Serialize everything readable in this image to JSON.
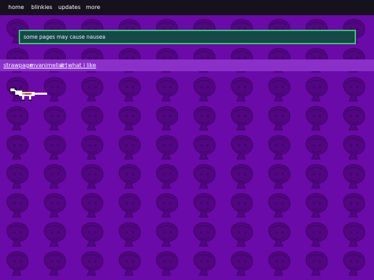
{
  "nav": {
    "items": [
      {
        "label": "home"
      },
      {
        "label": "blinkies"
      },
      {
        "label": "updates"
      },
      {
        "label": "more"
      }
    ]
  },
  "warning": {
    "text": "some pages may cause nausea"
  },
  "links": {
    "items": [
      {
        "label": "strawpage"
      },
      {
        "label": "mvanimelist"
      },
      {
        "label": "art"
      },
      {
        "label": "what i like"
      }
    ]
  },
  "colors": {
    "background": "#6a0aa8",
    "pattern": "#520682",
    "nav_bg": "#16121d",
    "warning_bg": "#154848",
    "warning_border": "#38c86a",
    "linkbar_bg": "#8a30c8"
  },
  "decoration": {
    "icon": "dinosaur-pixel-icon"
  }
}
